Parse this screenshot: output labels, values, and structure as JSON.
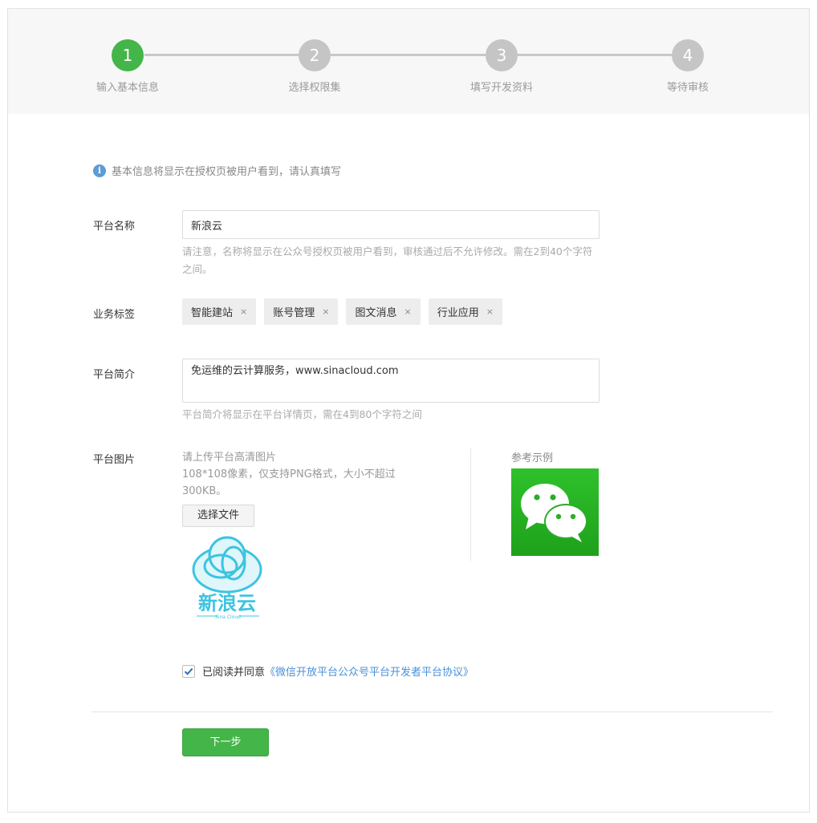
{
  "stepper": {
    "steps": [
      {
        "number": "1",
        "label": "输入基本信息",
        "active": true
      },
      {
        "number": "2",
        "label": "选择权限集",
        "active": false
      },
      {
        "number": "3",
        "label": "填写开发资料",
        "active": false
      },
      {
        "number": "4",
        "label": "等待审核",
        "active": false
      }
    ]
  },
  "notice": {
    "icon": "info-icon",
    "icon_glyph": "i",
    "text": "基本信息将显示在授权页被用户看到，请认真填写"
  },
  "platform_name": {
    "label": "平台名称",
    "value": "新浪云",
    "hint": "请注意，名称将显示在公众号授权页被用户看到，审核通过后不允许修改。需在2到40个字符之间。"
  },
  "business_tags": {
    "label": "业务标签",
    "tags": [
      "智能建站",
      "账号管理",
      "图文消息",
      "行业应用"
    ],
    "remove_glyph": "×"
  },
  "platform_intro": {
    "label": "平台简介",
    "value": "免运维的云计算服务，www.sinacloud.com",
    "hint": "平台简介将显示在平台详情页，需在4到80个字符之间"
  },
  "platform_image": {
    "label": "平台图片",
    "upload_line1": "请上传平台高清图片",
    "upload_line2": "108*108像素，仅支持PNG格式，大小不超过300KB。",
    "choose_file_label": "选择文件",
    "uploaded_logo_text": "新浪云",
    "uploaded_logo_subtext": "Sina Cloud",
    "example_label": "参考示例",
    "example_icon": "wechat-icon"
  },
  "agreement": {
    "checked": true,
    "text": "已阅读并同意",
    "link_text": "《微信开放平台公众号平台开发者平台协议》"
  },
  "next_button": {
    "label": "下一步"
  },
  "colors": {
    "accent_green": "#44b549",
    "link_blue": "#4a90d9",
    "step_inactive": "#c5c5c5",
    "wechat_green": "#2bad28"
  }
}
